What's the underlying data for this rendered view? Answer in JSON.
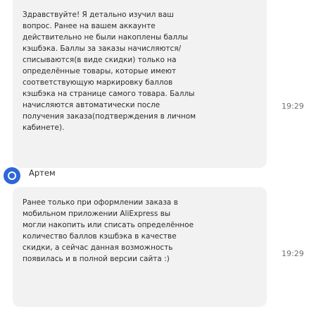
{
  "messages": [
    {
      "text": "Здравствуйте! Я детально изучил ваш\nвопрос. Ранее на вашем аккаунте\nдействительно не были накоплены баллы\nкэшбэка. Баллы за заказы начисляются/\nсписываются(в виде скидки) только на\nопределённые товары, которые имеют\nсоответствующую маркировку баллов\nкэшбэка на странице самого товара. Баллы\nначисляются автоматически после\nполучения заказа(подтверждения в личном\nкабинете).",
      "time": "19:29"
    },
    {
      "sender": "Артем",
      "text": "Ранее только при оформлении заказа в\nмобильном приложении AliExpress вы\nмогли накопить или списать определённое\nколичество баллов кэшбэка в качестве\nскидки, а сейчас данная возможность\nпоявилась и в полной версии сайта :)",
      "time": "19:29"
    }
  ]
}
